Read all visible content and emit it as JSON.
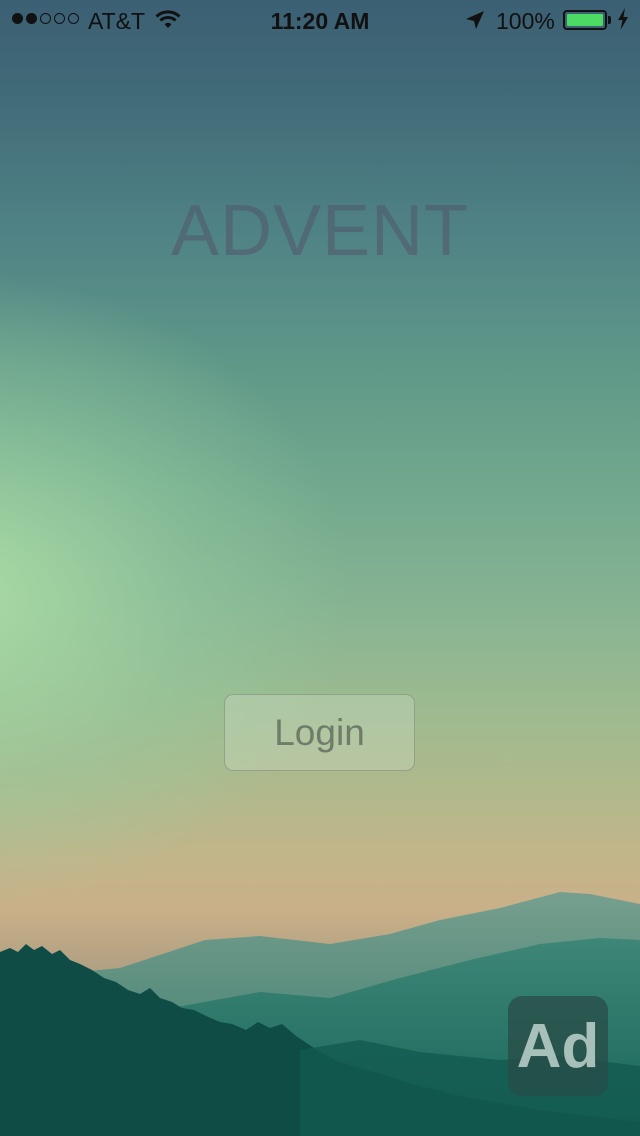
{
  "status_bar": {
    "carrier": "AT&T",
    "time": "11:20 AM",
    "battery_percent": "100%",
    "signal_bars_filled": 2,
    "signal_bars_total": 5,
    "battery_level": 1.0,
    "icons": [
      "wifi-icon",
      "location-arrow-icon",
      "battery-icon",
      "charging-bolt-icon"
    ]
  },
  "app": {
    "title": "ADVENT"
  },
  "login": {
    "label": "Login"
  },
  "ad": {
    "label": "Ad"
  },
  "colors": {
    "battery_fill": "#4cd964",
    "sky_top": "#3b5f73",
    "sky_horizon": "#c9b088",
    "hills_dark": "#0e4a44"
  }
}
